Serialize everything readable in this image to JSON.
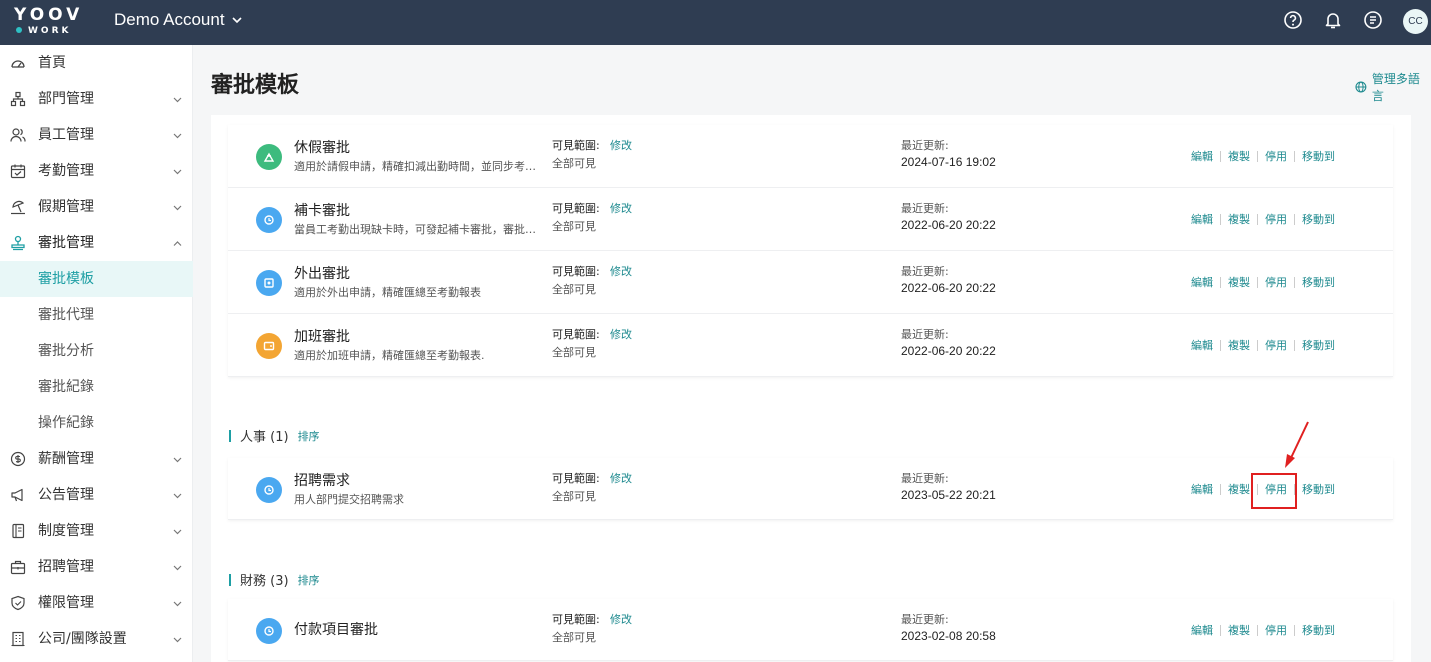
{
  "topbar": {
    "logo_top": "YOOV",
    "logo_bottom": "WORK",
    "account": "Demo Account",
    "avatar": "CC",
    "icons": [
      "help-icon",
      "bell-icon",
      "notes-icon"
    ]
  },
  "sidebar": {
    "items": [
      {
        "label": "首頁",
        "icon": "dashboard-icon",
        "expandable": false
      },
      {
        "label": "部門管理",
        "icon": "org-icon",
        "expandable": true
      },
      {
        "label": "員工管理",
        "icon": "people-icon",
        "expandable": true
      },
      {
        "label": "考勤管理",
        "icon": "calendar-icon",
        "expandable": true
      },
      {
        "label": "假期管理",
        "icon": "beach-icon",
        "expandable": true
      },
      {
        "label": "審批管理",
        "icon": "stamp-icon",
        "expandable": true,
        "expanded": true
      },
      {
        "label": "審批模板",
        "sub": true,
        "active": true
      },
      {
        "label": "審批代理",
        "sub": true
      },
      {
        "label": "審批分析",
        "sub": true
      },
      {
        "label": "審批紀錄",
        "sub": true
      },
      {
        "label": "操作紀錄",
        "sub": true
      },
      {
        "label": "薪酬管理",
        "icon": "dollar-icon",
        "expandable": true
      },
      {
        "label": "公告管理",
        "icon": "megaphone-icon",
        "expandable": true
      },
      {
        "label": "制度管理",
        "icon": "book-icon",
        "expandable": true
      },
      {
        "label": "招聘管理",
        "icon": "briefcase-icon",
        "expandable": true
      },
      {
        "label": "權限管理",
        "icon": "shield-icon",
        "expandable": true
      },
      {
        "label": "公司/團隊設置",
        "icon": "building-icon",
        "expandable": true
      }
    ]
  },
  "main": {
    "title": "審批模板",
    "lang_link": "管理多語言",
    "labels": {
      "scope": "可見範圍:",
      "scope_edit": "修改",
      "updated": "最近更新:"
    },
    "actions": [
      "編輯",
      "複製",
      "停用",
      "移動到"
    ],
    "groups": [
      {
        "name": "",
        "sort": "",
        "rows": [
          {
            "name": "休假審批",
            "desc": "適用於請假申請，精確扣減出勤時間，並同步考勤...",
            "scope": "全部可見",
            "updated": "2024-07-16 19:02",
            "icon": "leave-icon",
            "color": "#3dbb7e"
          },
          {
            "name": "補卡審批",
            "desc": "當員工考勤出現缺卡時，可發起補卡審批，審批通...",
            "scope": "全部可見",
            "updated": "2022-06-20 20:22",
            "icon": "punch-icon",
            "color": "#4aa8f0"
          },
          {
            "name": "外出審批",
            "desc": "適用於外出申請，精確匯總至考勤報表",
            "scope": "全部可見",
            "updated": "2022-06-20 20:22",
            "icon": "outing-icon",
            "color": "#4aa8f0"
          },
          {
            "name": "加班審批",
            "desc": "適用於加班申請，精確匯總至考勤報表.",
            "scope": "全部可見",
            "updated": "2022-06-20 20:22",
            "icon": "overtime-icon",
            "color": "#f3a533"
          }
        ]
      },
      {
        "name": "人事 (1)",
        "sort": "排序",
        "rows": [
          {
            "name": "招聘需求",
            "desc": "用人部門提交招聘需求",
            "scope": "全部可見",
            "updated": "2023-05-22 20:21",
            "icon": "recruit-icon",
            "color": "#4aa8f0"
          }
        ]
      },
      {
        "name": "財務 (3)",
        "sort": "排序",
        "rows": [
          {
            "name": "付款項目審批",
            "desc": "",
            "scope": "全部可見",
            "updated": "2023-02-08 20:58",
            "icon": "payment-icon",
            "color": "#4aa8f0"
          }
        ]
      }
    ]
  }
}
